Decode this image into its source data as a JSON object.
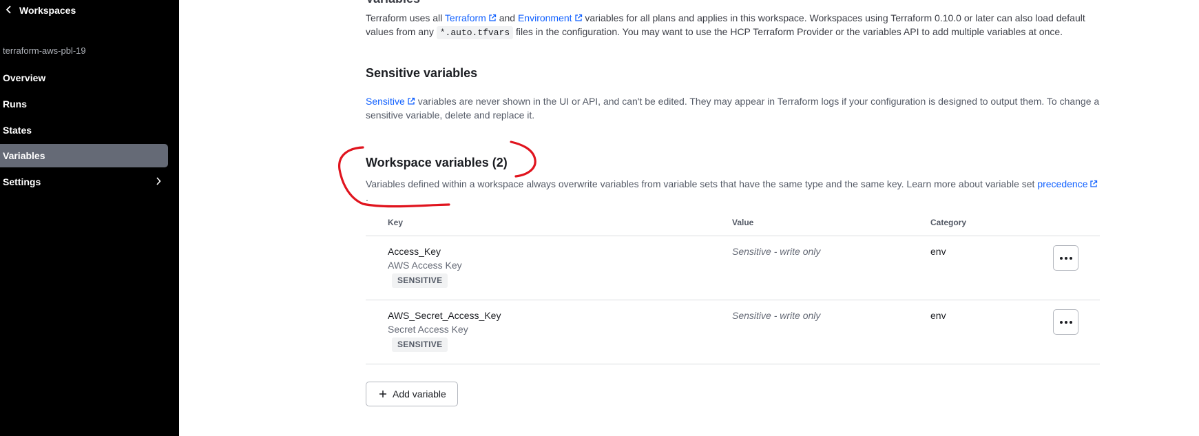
{
  "sidebar": {
    "back_label": "Workspaces",
    "workspace_name": "terraform-aws-pbl-19",
    "items": [
      {
        "label": "Overview"
      },
      {
        "label": "Runs"
      },
      {
        "label": "States"
      },
      {
        "label": "Variables",
        "active": true
      },
      {
        "label": "Settings",
        "has_chevron": true
      }
    ]
  },
  "intro": {
    "title": "Variables",
    "text_1": "Terraform uses all ",
    "link_terraform": "Terraform",
    "text_2": " and ",
    "link_environment": "Environment",
    "text_3": " variables for all plans and applies in this workspace. Workspaces using Terraform 0.10.0 or later can also load default values from any ",
    "code": "*.auto.tfvars",
    "text_4": " files in the configuration. You may want to use the HCP Terraform Provider or the variables API to add multiple variables at once."
  },
  "sensitive_section": {
    "title": "Sensitive variables",
    "link": "Sensitive",
    "text": " variables are never shown in the UI or API, and can't be edited. They may appear in Terraform logs if your configuration is designed to output them. To change a sensitive variable, delete and replace it."
  },
  "workspace_section": {
    "title": "Workspace variables (2)",
    "text": "Variables defined within a workspace always overwrite variables from variable sets that have the same type and the same key. Learn more about variable set ",
    "link": "precedence",
    "text_end": "."
  },
  "table": {
    "headers": {
      "key": "Key",
      "value": "Value",
      "category": "Category"
    },
    "rows": [
      {
        "key": "Access_Key",
        "description": "AWS Access Key",
        "badge": "SENSITIVE",
        "value": "Sensitive - write only",
        "category": "env"
      },
      {
        "key": "AWS_Secret_Access_Key",
        "description": "Secret Access Key",
        "badge": "SENSITIVE",
        "value": "Sensitive - write only",
        "category": "env"
      }
    ]
  },
  "add_variable_label": "Add variable",
  "colors": {
    "sidebar_bg": "#000000",
    "active_item_bg": "#656a76",
    "link": "#1060ff",
    "annotation": "#e0141e"
  }
}
